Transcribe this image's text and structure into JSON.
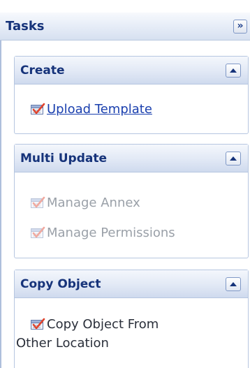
{
  "panel": {
    "title": "Tasks",
    "collapse_all_glyph": "»"
  },
  "sections": [
    {
      "title": "Create",
      "items": [
        {
          "label": "Upload Template",
          "state": "link",
          "icon": "checklist-icon"
        }
      ]
    },
    {
      "title": "Multi Update",
      "items": [
        {
          "label": "Manage Annex",
          "state": "disabled",
          "icon": "checklist-icon"
        },
        {
          "label": "Manage Permissions",
          "state": "disabled",
          "icon": "checklist-icon"
        }
      ]
    },
    {
      "title": "Copy Object",
      "items": [
        {
          "label_line1": "Copy Object From",
          "label_line2": "Other Location",
          "state": "normal",
          "icon": "checklist-icon"
        }
      ]
    }
  ],
  "colors": {
    "header_text": "#16337a",
    "link": "#1a3fae",
    "disabled": "#9aa0a8",
    "border": "#b6c6e0"
  }
}
